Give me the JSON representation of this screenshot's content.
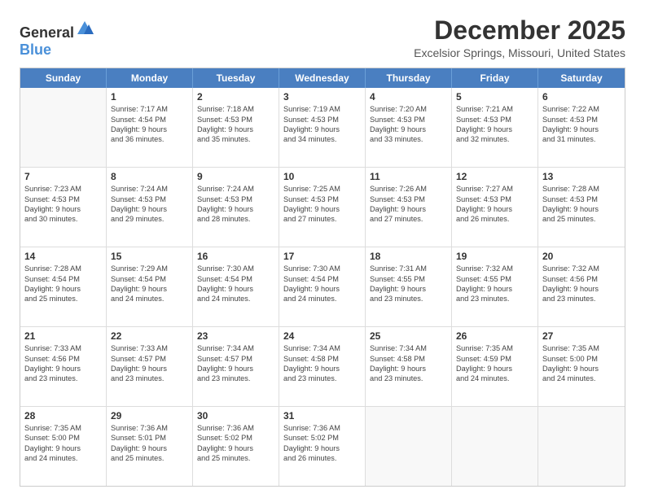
{
  "logo": {
    "general": "General",
    "blue": "Blue"
  },
  "title": "December 2025",
  "subtitle": "Excelsior Springs, Missouri, United States",
  "header_days": [
    "Sunday",
    "Monday",
    "Tuesday",
    "Wednesday",
    "Thursday",
    "Friday",
    "Saturday"
  ],
  "rows": [
    [
      {
        "day": "",
        "lines": []
      },
      {
        "day": "1",
        "lines": [
          "Sunrise: 7:17 AM",
          "Sunset: 4:54 PM",
          "Daylight: 9 hours",
          "and 36 minutes."
        ]
      },
      {
        "day": "2",
        "lines": [
          "Sunrise: 7:18 AM",
          "Sunset: 4:53 PM",
          "Daylight: 9 hours",
          "and 35 minutes."
        ]
      },
      {
        "day": "3",
        "lines": [
          "Sunrise: 7:19 AM",
          "Sunset: 4:53 PM",
          "Daylight: 9 hours",
          "and 34 minutes."
        ]
      },
      {
        "day": "4",
        "lines": [
          "Sunrise: 7:20 AM",
          "Sunset: 4:53 PM",
          "Daylight: 9 hours",
          "and 33 minutes."
        ]
      },
      {
        "day": "5",
        "lines": [
          "Sunrise: 7:21 AM",
          "Sunset: 4:53 PM",
          "Daylight: 9 hours",
          "and 32 minutes."
        ]
      },
      {
        "day": "6",
        "lines": [
          "Sunrise: 7:22 AM",
          "Sunset: 4:53 PM",
          "Daylight: 9 hours",
          "and 31 minutes."
        ]
      }
    ],
    [
      {
        "day": "7",
        "lines": [
          "Sunrise: 7:23 AM",
          "Sunset: 4:53 PM",
          "Daylight: 9 hours",
          "and 30 minutes."
        ]
      },
      {
        "day": "8",
        "lines": [
          "Sunrise: 7:24 AM",
          "Sunset: 4:53 PM",
          "Daylight: 9 hours",
          "and 29 minutes."
        ]
      },
      {
        "day": "9",
        "lines": [
          "Sunrise: 7:24 AM",
          "Sunset: 4:53 PM",
          "Daylight: 9 hours",
          "and 28 minutes."
        ]
      },
      {
        "day": "10",
        "lines": [
          "Sunrise: 7:25 AM",
          "Sunset: 4:53 PM",
          "Daylight: 9 hours",
          "and 27 minutes."
        ]
      },
      {
        "day": "11",
        "lines": [
          "Sunrise: 7:26 AM",
          "Sunset: 4:53 PM",
          "Daylight: 9 hours",
          "and 27 minutes."
        ]
      },
      {
        "day": "12",
        "lines": [
          "Sunrise: 7:27 AM",
          "Sunset: 4:53 PM",
          "Daylight: 9 hours",
          "and 26 minutes."
        ]
      },
      {
        "day": "13",
        "lines": [
          "Sunrise: 7:28 AM",
          "Sunset: 4:53 PM",
          "Daylight: 9 hours",
          "and 25 minutes."
        ]
      }
    ],
    [
      {
        "day": "14",
        "lines": [
          "Sunrise: 7:28 AM",
          "Sunset: 4:54 PM",
          "Daylight: 9 hours",
          "and 25 minutes."
        ]
      },
      {
        "day": "15",
        "lines": [
          "Sunrise: 7:29 AM",
          "Sunset: 4:54 PM",
          "Daylight: 9 hours",
          "and 24 minutes."
        ]
      },
      {
        "day": "16",
        "lines": [
          "Sunrise: 7:30 AM",
          "Sunset: 4:54 PM",
          "Daylight: 9 hours",
          "and 24 minutes."
        ]
      },
      {
        "day": "17",
        "lines": [
          "Sunrise: 7:30 AM",
          "Sunset: 4:54 PM",
          "Daylight: 9 hours",
          "and 24 minutes."
        ]
      },
      {
        "day": "18",
        "lines": [
          "Sunrise: 7:31 AM",
          "Sunset: 4:55 PM",
          "Daylight: 9 hours",
          "and 23 minutes."
        ]
      },
      {
        "day": "19",
        "lines": [
          "Sunrise: 7:32 AM",
          "Sunset: 4:55 PM",
          "Daylight: 9 hours",
          "and 23 minutes."
        ]
      },
      {
        "day": "20",
        "lines": [
          "Sunrise: 7:32 AM",
          "Sunset: 4:56 PM",
          "Daylight: 9 hours",
          "and 23 minutes."
        ]
      }
    ],
    [
      {
        "day": "21",
        "lines": [
          "Sunrise: 7:33 AM",
          "Sunset: 4:56 PM",
          "Daylight: 9 hours",
          "and 23 minutes."
        ]
      },
      {
        "day": "22",
        "lines": [
          "Sunrise: 7:33 AM",
          "Sunset: 4:57 PM",
          "Daylight: 9 hours",
          "and 23 minutes."
        ]
      },
      {
        "day": "23",
        "lines": [
          "Sunrise: 7:34 AM",
          "Sunset: 4:57 PM",
          "Daylight: 9 hours",
          "and 23 minutes."
        ]
      },
      {
        "day": "24",
        "lines": [
          "Sunrise: 7:34 AM",
          "Sunset: 4:58 PM",
          "Daylight: 9 hours",
          "and 23 minutes."
        ]
      },
      {
        "day": "25",
        "lines": [
          "Sunrise: 7:34 AM",
          "Sunset: 4:58 PM",
          "Daylight: 9 hours",
          "and 23 minutes."
        ]
      },
      {
        "day": "26",
        "lines": [
          "Sunrise: 7:35 AM",
          "Sunset: 4:59 PM",
          "Daylight: 9 hours",
          "and 24 minutes."
        ]
      },
      {
        "day": "27",
        "lines": [
          "Sunrise: 7:35 AM",
          "Sunset: 5:00 PM",
          "Daylight: 9 hours",
          "and 24 minutes."
        ]
      }
    ],
    [
      {
        "day": "28",
        "lines": [
          "Sunrise: 7:35 AM",
          "Sunset: 5:00 PM",
          "Daylight: 9 hours",
          "and 24 minutes."
        ]
      },
      {
        "day": "29",
        "lines": [
          "Sunrise: 7:36 AM",
          "Sunset: 5:01 PM",
          "Daylight: 9 hours",
          "and 25 minutes."
        ]
      },
      {
        "day": "30",
        "lines": [
          "Sunrise: 7:36 AM",
          "Sunset: 5:02 PM",
          "Daylight: 9 hours",
          "and 25 minutes."
        ]
      },
      {
        "day": "31",
        "lines": [
          "Sunrise: 7:36 AM",
          "Sunset: 5:02 PM",
          "Daylight: 9 hours",
          "and 26 minutes."
        ]
      },
      {
        "day": "",
        "lines": []
      },
      {
        "day": "",
        "lines": []
      },
      {
        "day": "",
        "lines": []
      }
    ]
  ]
}
